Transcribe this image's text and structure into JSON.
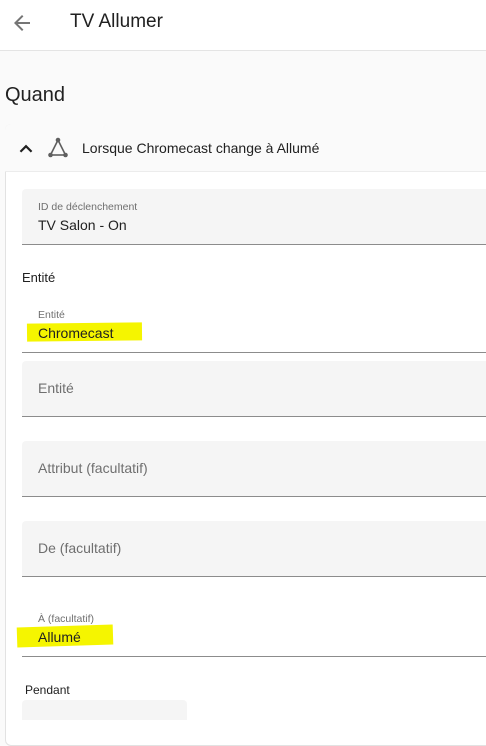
{
  "topbar": {
    "back_icon": "arrow-left-icon",
    "title": "TV Allumer"
  },
  "section": {
    "title": "Quand"
  },
  "trigger": {
    "collapse_icon": "chevron-up-icon",
    "type_icon": "state-trigger-icon",
    "summary": "Lorsque Chromecast change à Allumé",
    "trigger_id": {
      "label": "ID de déclenchement",
      "value": "TV Salon - On"
    },
    "entity_heading": "Entité",
    "entity": {
      "label": "Entité",
      "value": "Chromecast"
    },
    "entity_add": {
      "placeholder": "Entité"
    },
    "attribute": {
      "placeholder": "Attribut (facultatif)"
    },
    "from": {
      "placeholder": "De (facultatif)"
    },
    "to": {
      "label": "À (facultatif)",
      "value": "Allumé"
    },
    "for": {
      "label": "Pendant"
    }
  },
  "colors": {
    "highlight": "#f5f500",
    "field_bg": "#f5f5f5",
    "field_underline": "#8c8c8c"
  }
}
